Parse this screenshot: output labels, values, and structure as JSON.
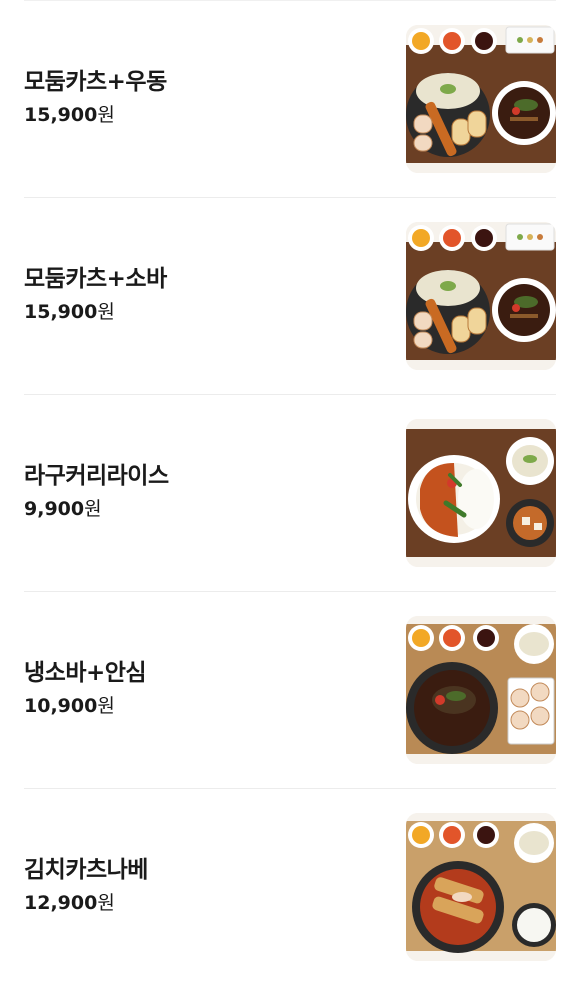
{
  "menu": {
    "items": [
      {
        "name": "모둠카츠+우동",
        "price": "15,900",
        "unit": "원",
        "image_icon": "food-photo-icon"
      },
      {
        "name": "모둠카츠+소바",
        "price": "15,900",
        "unit": "원",
        "image_icon": "food-photo-icon"
      },
      {
        "name": "라구커리라이스",
        "price": "9,900",
        "unit": "원",
        "image_icon": "food-photo-icon"
      },
      {
        "name": "냉소바+안심",
        "price": "10,900",
        "unit": "원",
        "image_icon": "food-photo-icon"
      },
      {
        "name": "김치카츠나베",
        "price": "12,900",
        "unit": "원",
        "image_icon": "food-photo-icon"
      }
    ]
  },
  "colors": {
    "table_wood": "#6b3f24",
    "soup_broth": "#3a1c10",
    "curry": "#c4521e",
    "divider": "#ececec"
  }
}
